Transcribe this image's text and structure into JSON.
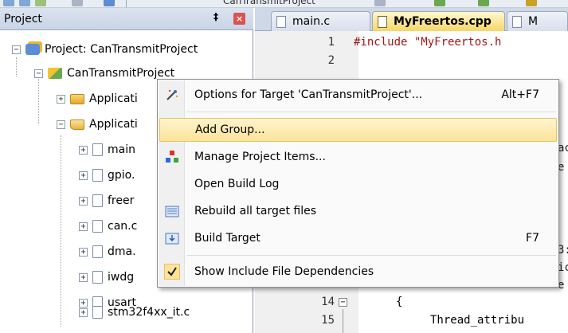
{
  "toolbar": {
    "project_name_fragment": "CanTransmitProject"
  },
  "project_panel": {
    "title": "Project",
    "pin_glyph": "‡",
    "close_glyph": "×",
    "root": "Project: CanTransmitProject",
    "target": "CanTransmitProject",
    "groups": [
      "Applicati",
      "Applicati"
    ],
    "files": [
      "main",
      "gpio.",
      "freer",
      "can.c",
      "dma.",
      "iwdg",
      "usart",
      "stm32f4xx_it.c"
    ]
  },
  "editor": {
    "tabs": [
      "main.c",
      "MyFreertos.cpp",
      "M"
    ],
    "active_tab": 1,
    "line_numbers": [
      "1",
      "2",
      "14",
      "15"
    ],
    "code": {
      "line1": "#include \"MyFreertos.h",
      "line14": "{",
      "line15": "Thread_attribu"
    },
    "partial_fragments": [
      "ac",
      "e",
      "3:",
      "ic",
      "e"
    ]
  },
  "context_menu": {
    "items": [
      {
        "label": "Options for Target 'CanTransmitProject'...",
        "shortcut": "Alt+F7",
        "icon": "magic-wand-icon",
        "highlighted": false
      },
      {
        "label": "Add Group...",
        "shortcut": "",
        "icon": "",
        "highlighted": true
      },
      {
        "label": "Manage Project Items...",
        "shortcut": "",
        "icon": "project-items-icon",
        "highlighted": false
      },
      {
        "label": "Open Build Log",
        "shortcut": "",
        "icon": "",
        "highlighted": false
      },
      {
        "label": "Rebuild all target files",
        "shortcut": "",
        "icon": "rebuild-icon",
        "highlighted": false
      },
      {
        "label": "Build Target",
        "shortcut": "F7",
        "icon": "build-icon",
        "highlighted": false
      },
      {
        "label": "Show Include File Dependencies",
        "shortcut": "",
        "icon": "checkmark-icon",
        "highlighted": false,
        "checked": true
      }
    ]
  },
  "colors": {
    "menu_highlight": "#fbe39a",
    "active_tab": "#f6d76a",
    "include_string": "#a31515"
  }
}
